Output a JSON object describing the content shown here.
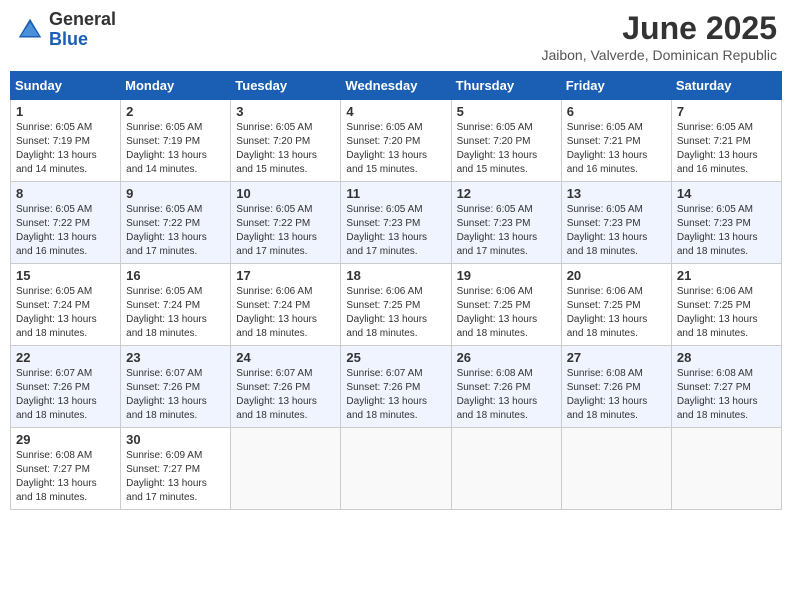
{
  "header": {
    "logo_general": "General",
    "logo_blue": "Blue",
    "month_year": "June 2025",
    "location": "Jaibon, Valverde, Dominican Republic"
  },
  "calendar": {
    "days_of_week": [
      "Sunday",
      "Monday",
      "Tuesday",
      "Wednesday",
      "Thursday",
      "Friday",
      "Saturday"
    ],
    "weeks": [
      [
        {
          "day": "1",
          "sunrise": "Sunrise: 6:05 AM",
          "sunset": "Sunset: 7:19 PM",
          "daylight": "Daylight: 13 hours and 14 minutes."
        },
        {
          "day": "2",
          "sunrise": "Sunrise: 6:05 AM",
          "sunset": "Sunset: 7:19 PM",
          "daylight": "Daylight: 13 hours and 14 minutes."
        },
        {
          "day": "3",
          "sunrise": "Sunrise: 6:05 AM",
          "sunset": "Sunset: 7:20 PM",
          "daylight": "Daylight: 13 hours and 15 minutes."
        },
        {
          "day": "4",
          "sunrise": "Sunrise: 6:05 AM",
          "sunset": "Sunset: 7:20 PM",
          "daylight": "Daylight: 13 hours and 15 minutes."
        },
        {
          "day": "5",
          "sunrise": "Sunrise: 6:05 AM",
          "sunset": "Sunset: 7:20 PM",
          "daylight": "Daylight: 13 hours and 15 minutes."
        },
        {
          "day": "6",
          "sunrise": "Sunrise: 6:05 AM",
          "sunset": "Sunset: 7:21 PM",
          "daylight": "Daylight: 13 hours and 16 minutes."
        },
        {
          "day": "7",
          "sunrise": "Sunrise: 6:05 AM",
          "sunset": "Sunset: 7:21 PM",
          "daylight": "Daylight: 13 hours and 16 minutes."
        }
      ],
      [
        {
          "day": "8",
          "sunrise": "Sunrise: 6:05 AM",
          "sunset": "Sunset: 7:22 PM",
          "daylight": "Daylight: 13 hours and 16 minutes."
        },
        {
          "day": "9",
          "sunrise": "Sunrise: 6:05 AM",
          "sunset": "Sunset: 7:22 PM",
          "daylight": "Daylight: 13 hours and 17 minutes."
        },
        {
          "day": "10",
          "sunrise": "Sunrise: 6:05 AM",
          "sunset": "Sunset: 7:22 PM",
          "daylight": "Daylight: 13 hours and 17 minutes."
        },
        {
          "day": "11",
          "sunrise": "Sunrise: 6:05 AM",
          "sunset": "Sunset: 7:23 PM",
          "daylight": "Daylight: 13 hours and 17 minutes."
        },
        {
          "day": "12",
          "sunrise": "Sunrise: 6:05 AM",
          "sunset": "Sunset: 7:23 PM",
          "daylight": "Daylight: 13 hours and 17 minutes."
        },
        {
          "day": "13",
          "sunrise": "Sunrise: 6:05 AM",
          "sunset": "Sunset: 7:23 PM",
          "daylight": "Daylight: 13 hours and 18 minutes."
        },
        {
          "day": "14",
          "sunrise": "Sunrise: 6:05 AM",
          "sunset": "Sunset: 7:23 PM",
          "daylight": "Daylight: 13 hours and 18 minutes."
        }
      ],
      [
        {
          "day": "15",
          "sunrise": "Sunrise: 6:05 AM",
          "sunset": "Sunset: 7:24 PM",
          "daylight": "Daylight: 13 hours and 18 minutes."
        },
        {
          "day": "16",
          "sunrise": "Sunrise: 6:05 AM",
          "sunset": "Sunset: 7:24 PM",
          "daylight": "Daylight: 13 hours and 18 minutes."
        },
        {
          "day": "17",
          "sunrise": "Sunrise: 6:06 AM",
          "sunset": "Sunset: 7:24 PM",
          "daylight": "Daylight: 13 hours and 18 minutes."
        },
        {
          "day": "18",
          "sunrise": "Sunrise: 6:06 AM",
          "sunset": "Sunset: 7:25 PM",
          "daylight": "Daylight: 13 hours and 18 minutes."
        },
        {
          "day": "19",
          "sunrise": "Sunrise: 6:06 AM",
          "sunset": "Sunset: 7:25 PM",
          "daylight": "Daylight: 13 hours and 18 minutes."
        },
        {
          "day": "20",
          "sunrise": "Sunrise: 6:06 AM",
          "sunset": "Sunset: 7:25 PM",
          "daylight": "Daylight: 13 hours and 18 minutes."
        },
        {
          "day": "21",
          "sunrise": "Sunrise: 6:06 AM",
          "sunset": "Sunset: 7:25 PM",
          "daylight": "Daylight: 13 hours and 18 minutes."
        }
      ],
      [
        {
          "day": "22",
          "sunrise": "Sunrise: 6:07 AM",
          "sunset": "Sunset: 7:26 PM",
          "daylight": "Daylight: 13 hours and 18 minutes."
        },
        {
          "day": "23",
          "sunrise": "Sunrise: 6:07 AM",
          "sunset": "Sunset: 7:26 PM",
          "daylight": "Daylight: 13 hours and 18 minutes."
        },
        {
          "day": "24",
          "sunrise": "Sunrise: 6:07 AM",
          "sunset": "Sunset: 7:26 PM",
          "daylight": "Daylight: 13 hours and 18 minutes."
        },
        {
          "day": "25",
          "sunrise": "Sunrise: 6:07 AM",
          "sunset": "Sunset: 7:26 PM",
          "daylight": "Daylight: 13 hours and 18 minutes."
        },
        {
          "day": "26",
          "sunrise": "Sunrise: 6:08 AM",
          "sunset": "Sunset: 7:26 PM",
          "daylight": "Daylight: 13 hours and 18 minutes."
        },
        {
          "day": "27",
          "sunrise": "Sunrise: 6:08 AM",
          "sunset": "Sunset: 7:26 PM",
          "daylight": "Daylight: 13 hours and 18 minutes."
        },
        {
          "day": "28",
          "sunrise": "Sunrise: 6:08 AM",
          "sunset": "Sunset: 7:27 PM",
          "daylight": "Daylight: 13 hours and 18 minutes."
        }
      ],
      [
        {
          "day": "29",
          "sunrise": "Sunrise: 6:08 AM",
          "sunset": "Sunset: 7:27 PM",
          "daylight": "Daylight: 13 hours and 18 minutes."
        },
        {
          "day": "30",
          "sunrise": "Sunrise: 6:09 AM",
          "sunset": "Sunset: 7:27 PM",
          "daylight": "Daylight: 13 hours and 17 minutes."
        },
        null,
        null,
        null,
        null,
        null
      ]
    ]
  }
}
